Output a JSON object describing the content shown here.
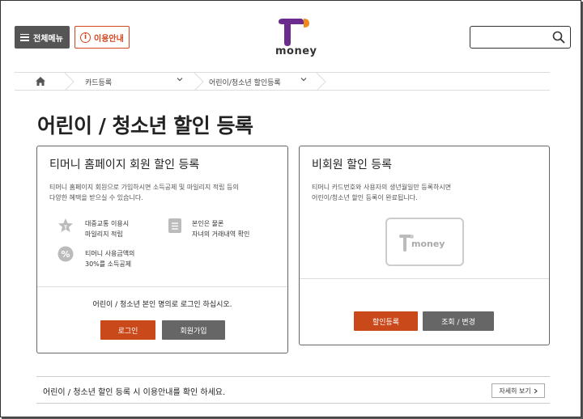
{
  "header": {
    "menu_label": "전체메뉴",
    "guide_label": "이용안내",
    "logo_text": "money",
    "search_placeholder": ""
  },
  "breadcrumb": {
    "items": [
      "카드등록",
      "어린이/청소년 할인등록"
    ]
  },
  "page_title": "어린이 / 청소년 할인 등록",
  "member_card": {
    "title": "티머니 홈페이지 회원 할인 등록",
    "desc_line1": "티머니 홈페이지 회원으로 가입하시면 소득공제 및 마일리지 적립 등의",
    "desc_line2": "다양한 혜택을 받으실 수 있습니다.",
    "features": [
      {
        "line1": "대중교통 이용시",
        "line2": "마일리지 적립",
        "icon": "star-icon"
      },
      {
        "line1": "본인은 물론",
        "line2": "자녀의 거래내역 확인",
        "icon": "list-icon"
      },
      {
        "line1": "티머니 사용금액의",
        "line2": "30%를 소득공제",
        "icon": "percent-icon"
      }
    ],
    "notice": "어린이 / 청소년 본인 명의로 로그인 하십시오.",
    "login_label": "로그인",
    "join_label": "회원가입"
  },
  "nonmember_card": {
    "title": "비회원 할인 등록",
    "desc_line1": "티머니 카드번호와 사용자의 생년월일만 등록하시면",
    "desc_line2": "어린이/청소년 할인 등록이 완료됩니다.",
    "card_text": "money",
    "register_label": "할인등록",
    "lookup_label": "조회 / 변경"
  },
  "bottom": {
    "text": "어린이 / 청소년 할인 등록 시 이용안내를 확인 하세요.",
    "more_label": "자세히 보기"
  },
  "colors": {
    "accent": "#c9491b",
    "logo_purple": "#6b2c8e",
    "logo_orange": "#f08a1c"
  }
}
